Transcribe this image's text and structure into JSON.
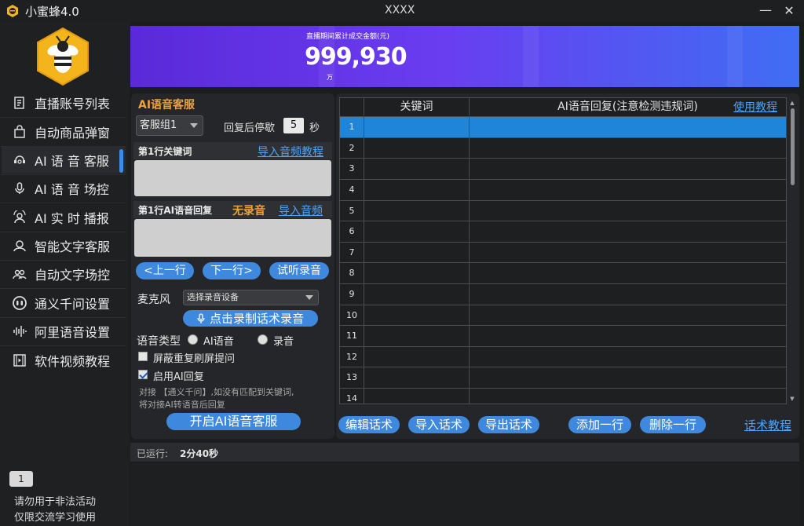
{
  "titlebar": {
    "app_title": "小蜜蜂4.0",
    "window_title": "XXXX",
    "min_label": "—",
    "close_label": "✕"
  },
  "sidebar": {
    "items": [
      {
        "label": "直播账号列表",
        "icon": "document-list-icon"
      },
      {
        "label": "自动商品弹窗",
        "icon": "shopping-bag-icon"
      },
      {
        "label": "AI 语 音 客服",
        "icon": "voice-agent-icon"
      },
      {
        "label": "AI 语 音 场控",
        "icon": "microphone-icon"
      },
      {
        "label": "AI 实 时 播报",
        "icon": "broadcast-user-icon"
      },
      {
        "label": "智能文字客服",
        "icon": "chat-agent-icon"
      },
      {
        "label": "自动文字场控",
        "icon": "users-icon"
      },
      {
        "label": "通义千问设置",
        "icon": "robot-face-icon"
      },
      {
        "label": "阿里语音设置",
        "icon": "waveform-icon"
      },
      {
        "label": "软件视频教程",
        "icon": "film-icon"
      }
    ],
    "active_index": 2,
    "notice_badge": "1",
    "notice_line1": "请勿用于非法活动",
    "notice_line2": "仅限交流学习使用"
  },
  "banner": {
    "caption": "直播期间累计成交金额(元)",
    "value": "999,930",
    "unit": "万"
  },
  "left_panel": {
    "title": "AI语音客服",
    "group_select": "客服组1",
    "pause_label": "回复后停歇",
    "pause_value": "5",
    "pause_unit": "秒",
    "keyword_head": "第1行关键词",
    "keyword_link": "导入音频教程",
    "reply_head": "第1行AI语音回复",
    "no_record": "无录音",
    "import_audio": "导入音频",
    "prev_btn": "<上一行",
    "next_btn": "下一行>",
    "listen_btn": "试听录音",
    "mic_label": "麦克风",
    "mic_select": "选择录音设备",
    "record_btn": "点击录制话术录音",
    "voice_type_label": "语音类型",
    "voice_opt_ai": "AI语音",
    "voice_opt_rec": "录音",
    "check_block": "屏蔽重复刷屏提问",
    "check_ai": "启用AI回复",
    "hint1": "对接 【通义千问】,如没有匹配到关键词,",
    "hint2": "将对接AI转语音后回复",
    "start_btn": "开启AI语音客服"
  },
  "table": {
    "col_keyword": "关键词",
    "col_reply": "AI语音回复(注意检测违规词)",
    "tutorial_link": "使用教程",
    "rows": [
      "1",
      "2",
      "3",
      "4",
      "5",
      "6",
      "7",
      "8",
      "9",
      "10",
      "11",
      "12",
      "13",
      "14"
    ],
    "selected_row": 0
  },
  "actions": {
    "edit": "编辑话术",
    "import": "导入话术",
    "export": "导出话术",
    "add_row": "添加一行",
    "delete_row": "删除一行",
    "script_tutorial": "话术教程"
  },
  "status": {
    "runtime_label": "已运行:",
    "runtime_value": "2分40秒"
  },
  "colors": {
    "accent": "#3e88de",
    "title_orange": "#f0a23a",
    "link_blue": "#4aa3ff",
    "selected_row": "#1f85d8"
  }
}
